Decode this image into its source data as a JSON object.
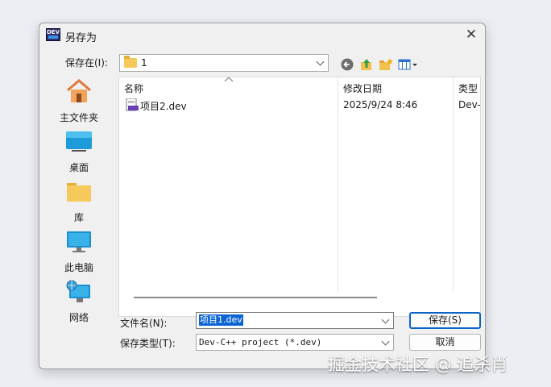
{
  "title": "另存为",
  "app_icon_text": "DEV",
  "close_glyph": "✕",
  "save_in": {
    "label": "保存在(I):",
    "value": "1"
  },
  "toolbar": [
    "back-icon",
    "up-folder-icon",
    "new-folder-icon",
    "view-menu-icon"
  ],
  "places": [
    {
      "icon": "home-icon",
      "label": "主文件夹"
    },
    {
      "icon": "desktop-icon",
      "label": "桌面"
    },
    {
      "icon": "folder-icon",
      "label": "库"
    },
    {
      "icon": "computer-icon",
      "label": "此电脑"
    },
    {
      "icon": "network-icon",
      "label": "网络"
    }
  ],
  "columns": {
    "name": "名称",
    "modified": "修改日期",
    "type": "类型"
  },
  "files": [
    {
      "name": "项目2.dev",
      "modified": "2025/9/24 8:46",
      "type": "Dev-"
    }
  ],
  "filename": {
    "label": "文件名(N):",
    "value": "项目1.dev"
  },
  "filetype": {
    "label": "保存类型(T):",
    "value": "Dev-C++ project (*.dev)"
  },
  "buttons": {
    "save": "保存(S)",
    "cancel": "取消"
  },
  "watermark": "掘金技术社区 @ 追杀肖"
}
